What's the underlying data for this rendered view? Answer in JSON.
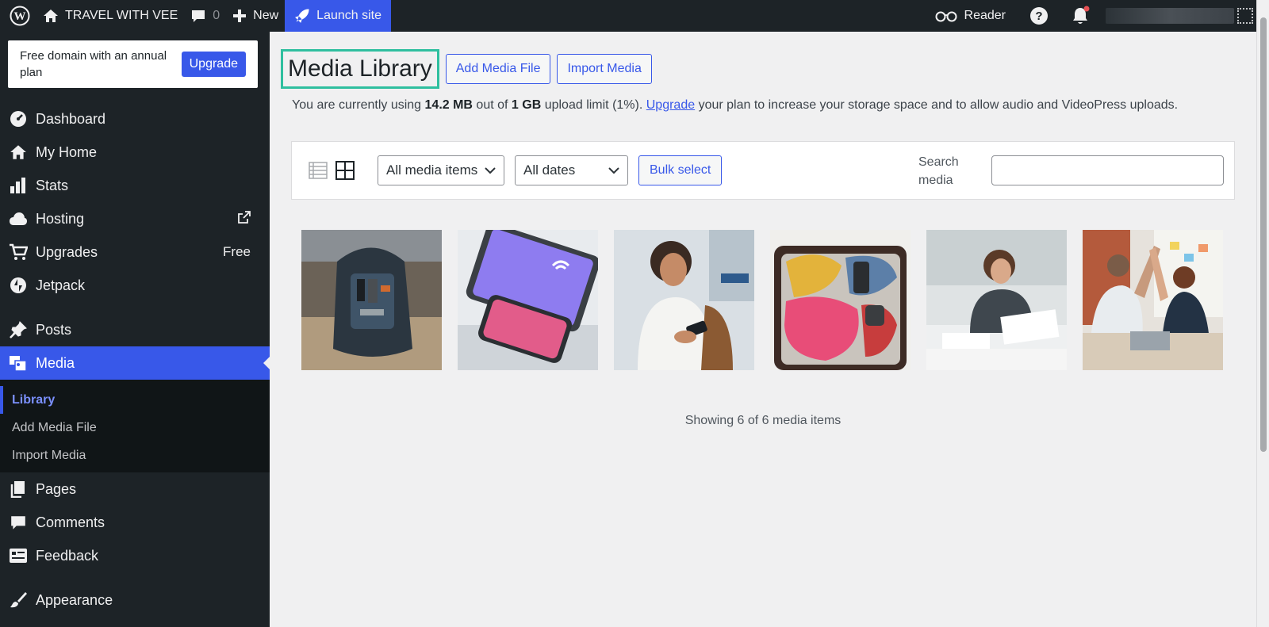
{
  "topbar": {
    "site_name": "TRAVEL WITH VEE",
    "comment_count": "0",
    "new_label": "New",
    "launch_label": "Launch site",
    "reader_label": "Reader"
  },
  "promo": {
    "text": "Free domain with an annual plan",
    "button": "Upgrade"
  },
  "sidebar": {
    "items": [
      {
        "label": "Dashboard",
        "icon": "dashboard-icon"
      },
      {
        "label": "My Home",
        "icon": "home-icon"
      },
      {
        "label": "Stats",
        "icon": "stats-icon"
      },
      {
        "label": "Hosting",
        "icon": "cloud-icon"
      },
      {
        "label": "Upgrades",
        "icon": "cart-icon",
        "badge": "Free"
      },
      {
        "label": "Jetpack",
        "icon": "jetpack-icon"
      },
      {
        "label": "Posts",
        "icon": "pin-icon"
      },
      {
        "label": "Media",
        "icon": "media-icon"
      },
      {
        "label": "Pages",
        "icon": "pages-icon"
      },
      {
        "label": "Comments",
        "icon": "comment-icon"
      },
      {
        "label": "Feedback",
        "icon": "feedback-icon"
      },
      {
        "label": "Appearance",
        "icon": "brush-icon"
      }
    ],
    "media_submenu": [
      "Library",
      "Add Media File",
      "Import Media"
    ]
  },
  "header": {
    "title": "Media Library",
    "add_button": "Add Media File",
    "import_button": "Import Media"
  },
  "quota": {
    "prefix": "You are currently using ",
    "used": "14.2 MB",
    "middle": " out of ",
    "limit": "1 GB",
    "suffix_before_link": " upload limit (1%). ",
    "link": "Upgrade",
    "suffix": " your plan to increase your storage space and to allow audio and VideoPress uploads."
  },
  "toolbar": {
    "filter_type": "All media items",
    "filter_date": "All dates",
    "bulk": "Bulk select",
    "search_label": "Search media",
    "search_placeholder": ""
  },
  "media_items": [
    "backpack photo",
    "devices photo",
    "woman with phone photo",
    "open suitcase photo",
    "woman reading documents photo",
    "office high-five photo"
  ],
  "footer": {
    "showing": "Showing 6 of 6 media items"
  },
  "colors": {
    "accent": "#3858e9",
    "admin_bar": "#1d2327",
    "highlight": "#2fbf9f"
  }
}
